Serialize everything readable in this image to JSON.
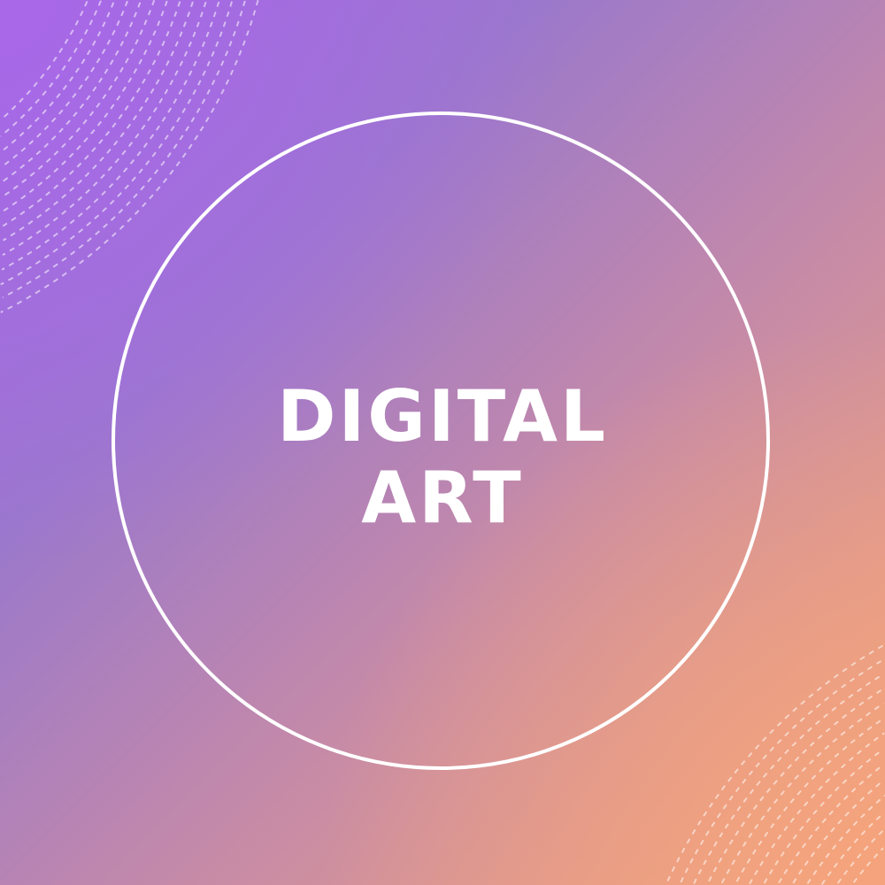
{
  "title": {
    "line1": "DIGITAL",
    "line2": "ART"
  },
  "colors": {
    "top_left": "#a868e8",
    "bottom_right": "#f5a67a",
    "ring": "#ffffff"
  }
}
